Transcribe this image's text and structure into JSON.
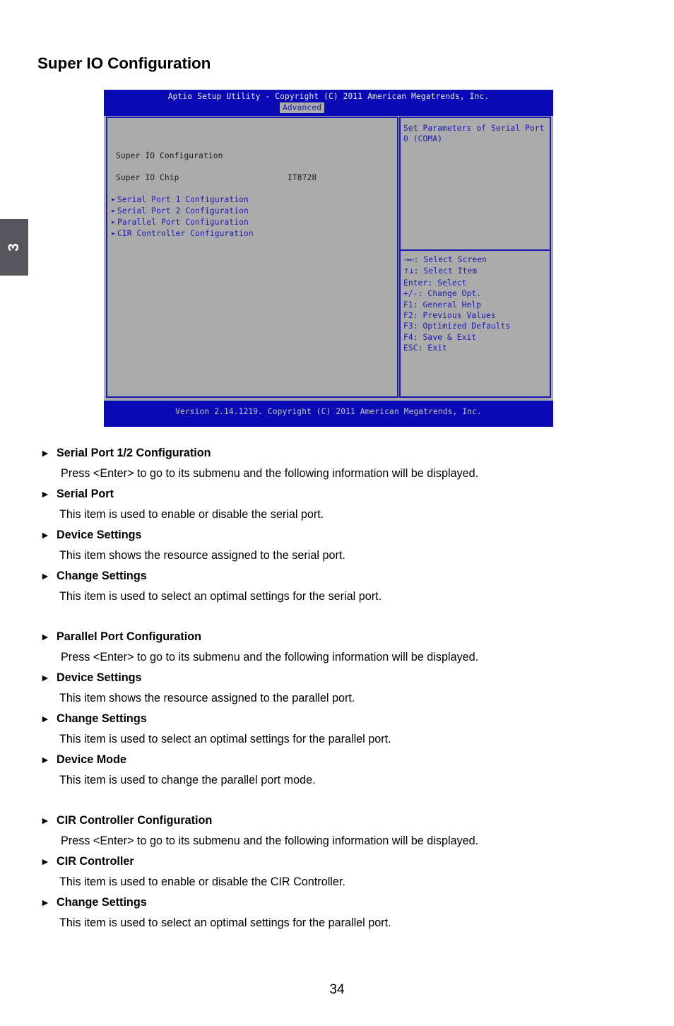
{
  "page": {
    "title": "Super IO Configuration",
    "chapter_tab": "3",
    "page_number": "34"
  },
  "bios": {
    "header_title": "Aptio Setup Utility - Copyright (C) 2011 American Megatrends, Inc.",
    "active_tab": "Advanced",
    "section_label": "Super IO Configuration",
    "chip_label": "Super IO Chip",
    "chip_value": "IT8728",
    "menu_items": [
      "Serial Port 1 Configuration",
      "Serial Port 2 Configuration",
      "Parallel Port Configuration",
      "CIR Controller Configuration"
    ],
    "help_text": "Set Parameters of Serial Port 0 (COMA)",
    "nav_keys": [
      {
        "glyph": "→←",
        "text": ": Select Screen"
      },
      {
        "glyph": "↑↓",
        "text": ": Select Item"
      },
      {
        "glyph": "",
        "text": "Enter: Select"
      },
      {
        "glyph": "",
        "text": "+/-: Change Opt."
      },
      {
        "glyph": "",
        "text": "F1: General Help"
      },
      {
        "glyph": "",
        "text": "F2: Previous Values"
      },
      {
        "glyph": "",
        "text": "F3: Optimized Defaults"
      },
      {
        "glyph": "",
        "text": "F4: Save & Exit"
      },
      {
        "glyph": "",
        "text": "ESC: Exit"
      }
    ],
    "footer_version": "Version 2.14.1219. Copyright (C) 2011 American Megatrends, Inc.",
    "colors": {
      "blue_bar": "#0a0ab4",
      "panel_gray": "#ababab",
      "menu_blue": "#1a1ab0"
    }
  },
  "descriptions": [
    {
      "bullet": "►",
      "heading": "Serial Port 1/2 Configuration",
      "text": "Press <Enter> to go to its submenu and the following information will be displayed."
    },
    {
      "bullet": "►",
      "heading": "Serial Port",
      "text": "This item is used to enable or disable the serial port."
    },
    {
      "bullet": "►",
      "heading": "Device Settings",
      "text": "This item shows the resource assigned to the serial port."
    },
    {
      "bullet": "►",
      "heading": "Change Settings",
      "text": "This item is used to select an optimal settings for the serial port."
    },
    {
      "bullet": "►",
      "heading": "Parallel Port Configuration",
      "text": "Press <Enter> to go to its submenu and the following information will be displayed."
    },
    {
      "bullet": "►",
      "heading": "Device Settings",
      "text": "This item shows the resource assigned to the parallel port."
    },
    {
      "bullet": "►",
      "heading": "Change Settings",
      "text": "This item is used to select an optimal settings for the parallel port."
    },
    {
      "bullet": "►",
      "heading": "Device Mode",
      "text": "This item is used to change the parallel port mode."
    },
    {
      "bullet": "►",
      "heading": "CIR Controller Configuration",
      "text": "Press <Enter> to go to its submenu and the following information will be displayed."
    },
    {
      "bullet": "►",
      "heading": "CIR Controller",
      "text": "This item is used to enable or disable the CIR Controller."
    },
    {
      "bullet": "►",
      "heading": "Change Settings",
      "text": "This item is used to select an optimal settings for the parallel port."
    }
  ],
  "group_breaks_after": [
    3,
    7
  ]
}
